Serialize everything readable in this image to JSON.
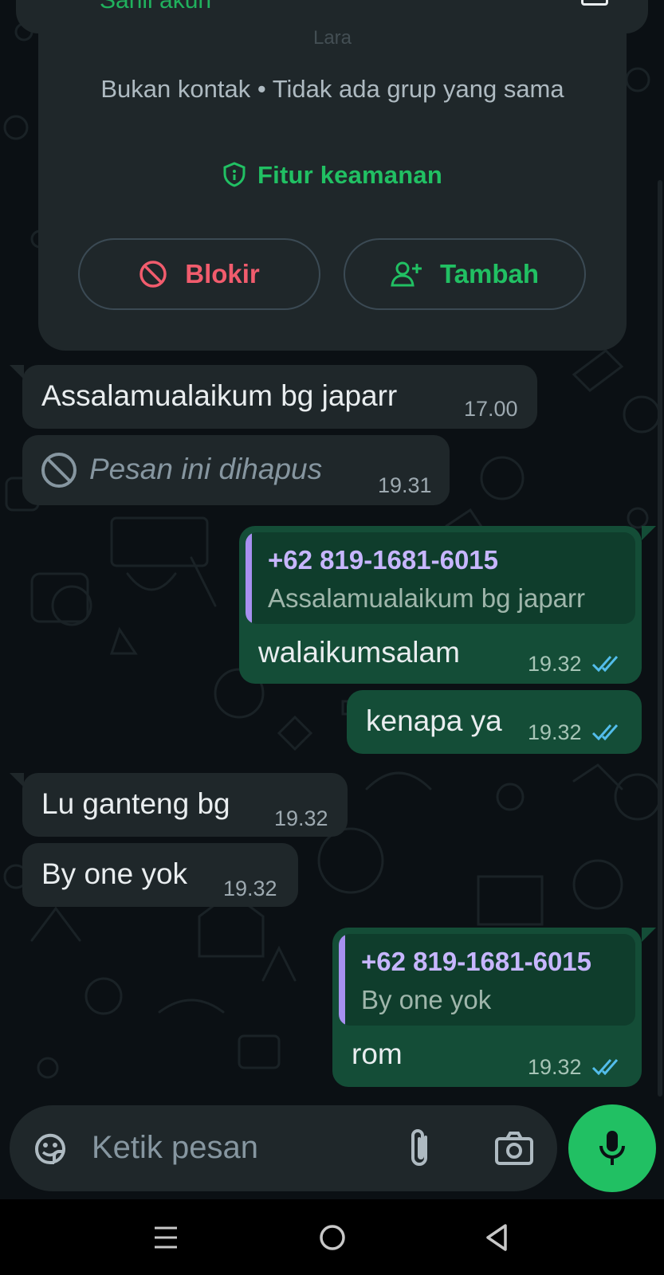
{
  "header": {
    "cut_title": "Sahil akun",
    "faded_line": "Lara"
  },
  "contact_card": {
    "subtitle": "Bukan kontak • Tidak ada grup yang sama",
    "security_label": "Fitur keamanan",
    "block_label": "Blokir",
    "add_label": "Tambah"
  },
  "messages": [
    {
      "dir": "in",
      "text": "Assalamualaikum bg japarr",
      "time": "17.00"
    },
    {
      "dir": "in",
      "text": "Pesan ini dihapus",
      "time": "19.31",
      "deleted": true
    },
    {
      "dir": "out",
      "quote_name": "+62 819-1681-6015",
      "quote_text": "Assalamualaikum bg japarr",
      "text": "walaikumsalam",
      "time": "19.32",
      "status": "read"
    },
    {
      "dir": "out",
      "text": "kenapa ya",
      "time": "19.32",
      "status": "read"
    },
    {
      "dir": "in",
      "text": "Lu ganteng bg",
      "time": "19.32"
    },
    {
      "dir": "in",
      "text": "By one yok",
      "time": "19.32"
    },
    {
      "dir": "out",
      "quote_name": "+62 819-1681-6015",
      "quote_text": "By one yok",
      "text": "rom",
      "time": "19.32",
      "status": "read"
    }
  ],
  "composer": {
    "placeholder": "Ketik pesan",
    "icons": [
      "sticker-icon",
      "attach-icon",
      "camera-icon",
      "mic-icon"
    ]
  },
  "navigation": {
    "icons": [
      "recent-apps-icon",
      "home-icon",
      "back-icon"
    ]
  },
  "colors": {
    "background": "#0b1014",
    "incoming": "#1f272a",
    "outgoing": "#144d37",
    "accent": "#21c063",
    "danger": "#f15c6d",
    "read_ticks": "#53bdeb"
  }
}
